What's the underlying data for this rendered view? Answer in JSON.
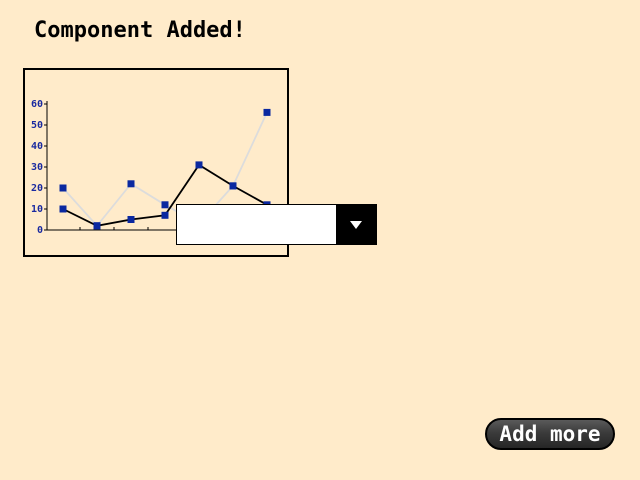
{
  "heading": "Component Added!",
  "dropdown": {
    "selected": ""
  },
  "add_more_label": "Add more",
  "colors": {
    "background": "#ffebca",
    "series_dark": "#000000",
    "series_light": "#dcdcdc",
    "marker": "#0a28a0",
    "tick_label": "#1a2aa0"
  },
  "icons": {
    "dropdown_arrow": "caret-down-icon"
  },
  "chart_data": {
    "type": "line",
    "x": [
      0,
      1,
      2,
      3,
      4,
      5,
      6
    ],
    "ylim": [
      0,
      60
    ],
    "yticks": [
      "0",
      "10",
      "20",
      "30",
      "40",
      "50",
      "60"
    ],
    "grid": false,
    "series": [
      {
        "values": [
          20,
          2,
          22,
          12,
          3,
          21,
          56
        ]
      },
      {
        "values": [
          10,
          2,
          5,
          7,
          31,
          21,
          12
        ]
      }
    ]
  }
}
